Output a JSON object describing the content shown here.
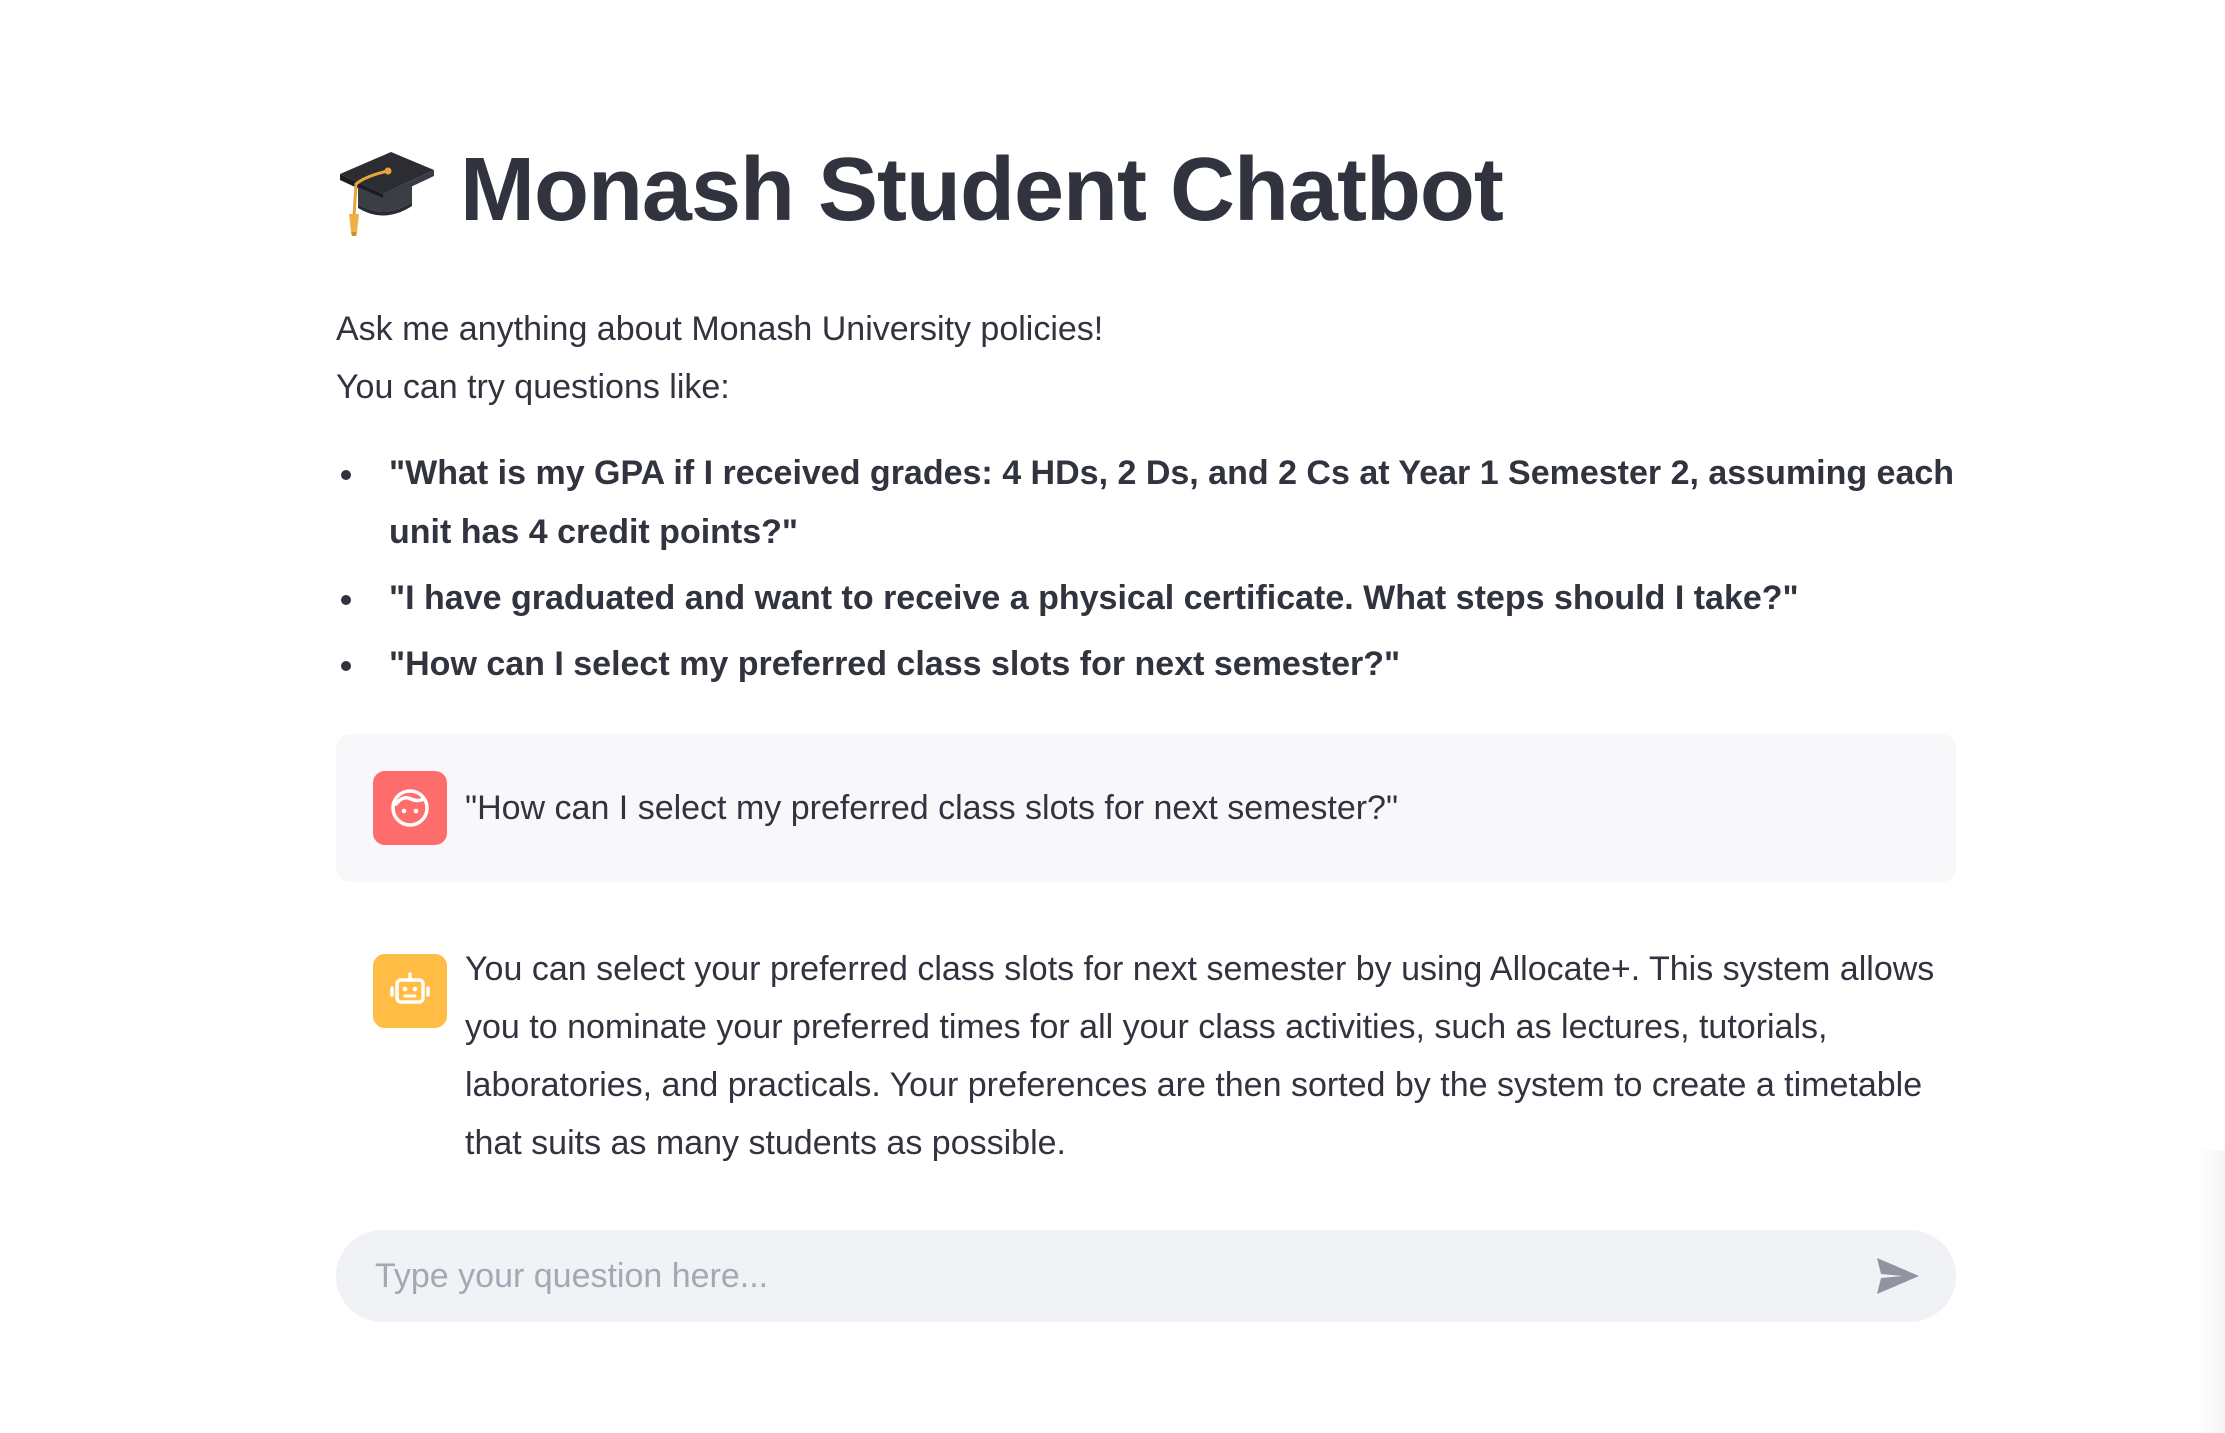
{
  "header": {
    "title": "Monash Student Chatbot",
    "title_icon": "graduation-cap-icon"
  },
  "intro": {
    "line1": "Ask me anything about Monash University policies!",
    "line2": "You can try questions like:"
  },
  "examples": [
    "\"What is my GPA if I received grades: 4 HDs, 2 Ds, and 2 Cs at Year 1 Semester 2, assuming each unit has 4 credit points?\"",
    "\"I have graduated and want to receive a physical certificate. What steps should I take?\"",
    "\"How can I select my preferred class slots for next semester?\""
  ],
  "messages": [
    {
      "role": "user",
      "avatar_icon": "user-face-icon",
      "avatar_color": "#ff6c6c",
      "text": "\"How can I select my preferred class slots for next semester?\""
    },
    {
      "role": "assistant",
      "avatar_icon": "robot-icon",
      "avatar_color": "#ffbd45",
      "text": "You can select your preferred class slots for next semester by using Allocate+. This system allows you to nominate your preferred times for all your class activities, such as lectures, tutorials, laboratories, and practicals. Your preferences are then sorted by the system to create a timetable that suits as many students as possible."
    }
  ],
  "chat_input": {
    "placeholder": "Type your question here...",
    "value": "",
    "send_icon": "send-icon"
  },
  "colors": {
    "text": "#31333f",
    "input_bg": "#f0f2f6",
    "user_msg_bg": "#f8f8fa",
    "placeholder": "#a3a8b4"
  }
}
